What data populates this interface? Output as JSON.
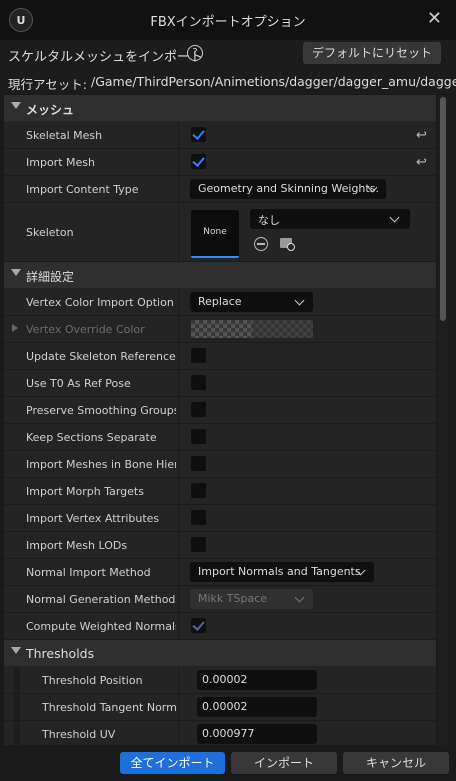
{
  "window": {
    "title": "FBXインポートオプション",
    "close_glyph": "✕",
    "logo_glyph": "U"
  },
  "header": {
    "label": "スケルタルメッシュをインポート",
    "help_glyph": "?",
    "reset_button": "デフォルトにリセット",
    "asset_label": "現行アセット:",
    "asset_path": "/Game/ThirdPerson/Animetions/dagger/dagger_amu/dagger_an"
  },
  "mesh_section": {
    "title": "メッシュ",
    "skeletal_mesh": {
      "label": "Skeletal Mesh",
      "checked": true
    },
    "import_mesh": {
      "label": "Import Mesh",
      "checked": true
    },
    "import_content_type": {
      "label": "Import Content Type",
      "value": "Geometry and Skinning Weights."
    },
    "skeleton": {
      "label": "Skeleton",
      "thumb_text": "None",
      "value": "なし"
    },
    "revert_glyph": "↩"
  },
  "advanced_section": {
    "title": "詳細設定",
    "rows": [
      {
        "label": "Vertex Color Import Option",
        "value": "Replace"
      },
      {
        "label": "Vertex Override Color"
      },
      {
        "label": "Update Skeleton Reference Pose",
        "checked": false
      },
      {
        "label": "Use T0 As Ref Pose",
        "checked": false
      },
      {
        "label": "Preserve Smoothing Groups",
        "checked": false
      },
      {
        "label": "Keep Sections Separate",
        "checked": false
      },
      {
        "label": "Import Meshes in Bone Hierarchy",
        "checked": false
      },
      {
        "label": "Import Morph Targets",
        "checked": false
      },
      {
        "label": "Import Vertex Attributes",
        "checked": false
      },
      {
        "label": "Import Mesh LODs",
        "checked": false
      },
      {
        "label": "Normal Import Method",
        "value": "Import Normals and Tangents"
      },
      {
        "label": "Normal Generation Method",
        "value": "Mikk TSpace"
      },
      {
        "label": "Compute Weighted Normals",
        "checked": true
      }
    ]
  },
  "thresholds_section": {
    "title": "Thresholds",
    "rows": [
      {
        "label": "Threshold Position",
        "value": "0.00002"
      },
      {
        "label": "Threshold Tangent Normal",
        "value": "0.00002"
      },
      {
        "label": "Threshold UV",
        "value": "0.000977"
      }
    ]
  },
  "footer": {
    "import_all": "全てインポート",
    "import": "インポート",
    "cancel": "キャンセル"
  },
  "colors": {
    "accent": "#1e6fd9",
    "check": "#2f7fff"
  }
}
